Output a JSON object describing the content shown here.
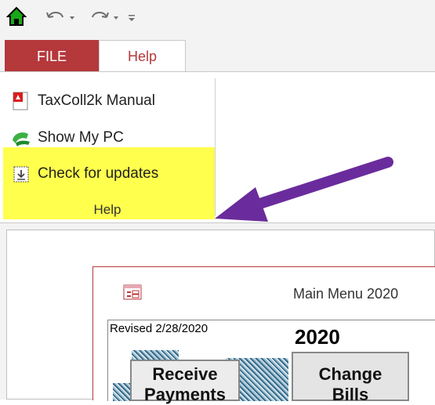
{
  "quick_access": {
    "home_icon": "house-icon",
    "undo_icon": "undo-icon",
    "redo_icon": "redo-icon",
    "customize_icon": "customize-qat-icon"
  },
  "tabs": {
    "file": "FILE",
    "help": "Help"
  },
  "ribbon": {
    "items": [
      {
        "label": "TaxColl2k Manual",
        "icon": "pdf-icon"
      },
      {
        "label": "Show My PC",
        "icon": "computer-icon"
      },
      {
        "label": "Check for updates",
        "icon": "download-icon"
      }
    ],
    "group_label": "Help",
    "highlight_color": "#ffff4d",
    "arrow_color": "#6a2c9c"
  },
  "form": {
    "title": "Main Menu 2020",
    "revised": "Revised 2/28/2020",
    "year": "2020",
    "buttons": {
      "receive_line1": "Receive",
      "receive_line2": "Payments",
      "change_line1": "Change",
      "change_line2": "Bills"
    }
  },
  "colors": {
    "file_tab": "#b5383b",
    "help_tab_text": "#b5383b"
  }
}
